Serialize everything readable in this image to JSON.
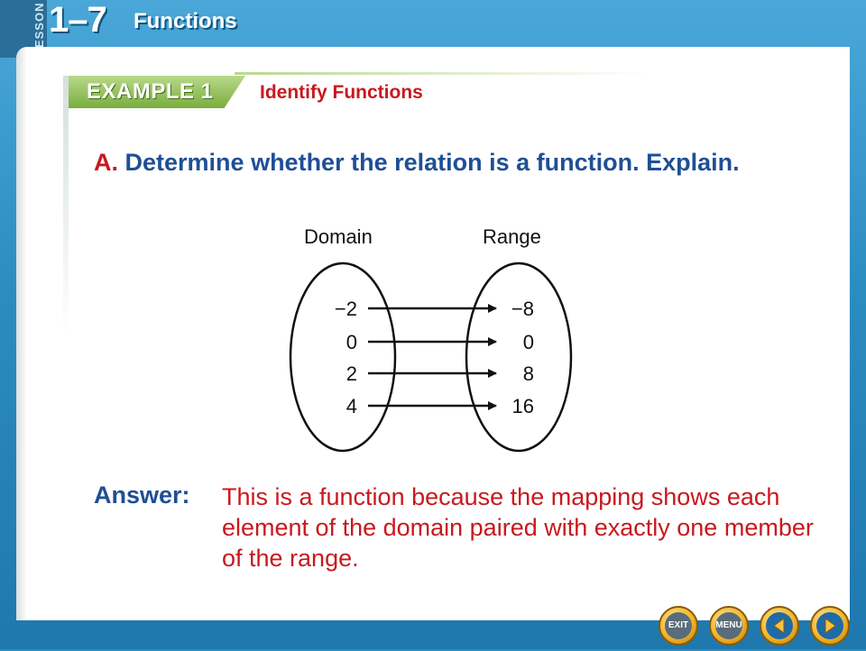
{
  "header": {
    "lesson_word": "LESSON",
    "lesson_number": "1–7",
    "title": "Functions"
  },
  "example": {
    "label": "EXAMPLE 1",
    "title": "Identify Functions"
  },
  "question": {
    "letter": "A.",
    "text": "Determine whether the relation is a function. Explain."
  },
  "mapping": {
    "domain_label": "Domain",
    "range_label": "Range",
    "domain": [
      "−2",
      "0",
      "2",
      "4"
    ],
    "range": [
      "−8",
      "0",
      "8",
      "16"
    ]
  },
  "answer": {
    "label": "Answer:",
    "text": "This is a function because the mapping shows each element of the domain paired with exactly one member of the range."
  },
  "nav": {
    "exit_label": "EXIT",
    "menu_label": "MENU"
  },
  "colors": {
    "frame_blue": "#2c8fc4",
    "title_blue": "#1f4f95",
    "accent_red": "#c8191e",
    "banner_green": "#79ad3c",
    "button_gold": "#f2b52a"
  }
}
